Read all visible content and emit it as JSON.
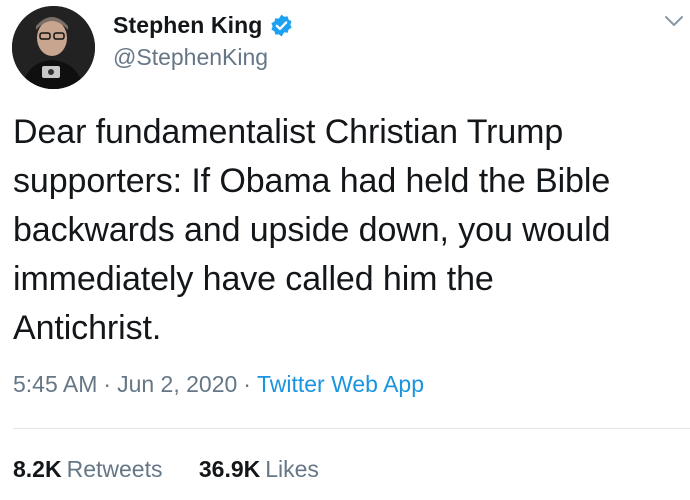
{
  "author": {
    "display_name": "Stephen King",
    "handle": "@StephenKing",
    "verified": true,
    "avatar_icon": "profile-photo",
    "verified_icon": "verified-badge-icon"
  },
  "tweet": {
    "lines": [
      "Dear fundamentalist Christian Trump",
      "supporters: If Obama had held the Bible",
      "backwards and upside down, you would",
      "immediately have called him the",
      "Antichrist."
    ]
  },
  "meta": {
    "time": "5:45 AM",
    "separator": "·",
    "date": "Jun 2, 2020",
    "source": "Twitter Web App"
  },
  "stats": {
    "retweets_count": "8.2K",
    "retweets_label": "Retweets",
    "likes_count": "36.9K",
    "likes_label": "Likes"
  },
  "colors": {
    "text": "#14171a",
    "secondary": "#657786",
    "link": "#1b95e0",
    "verified": "#1da1f2",
    "divider": "#e1e8ed"
  }
}
